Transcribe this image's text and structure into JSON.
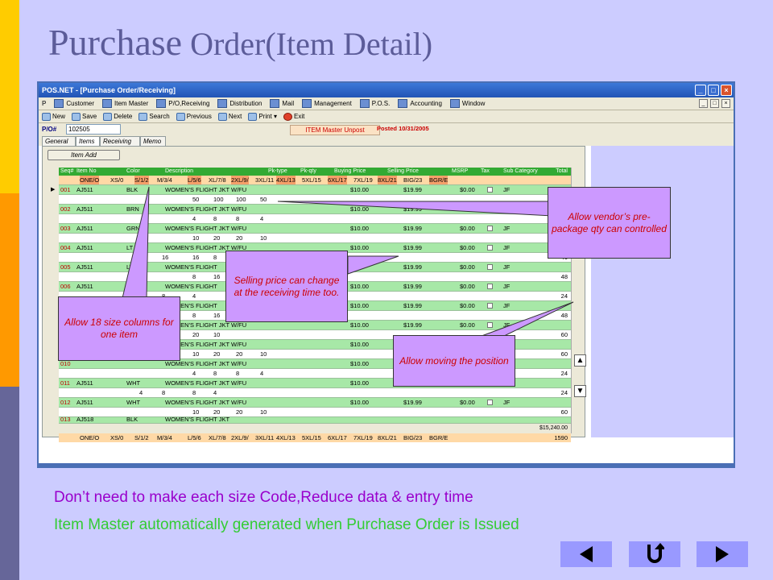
{
  "slide": {
    "title_main": "Purchase",
    "title_rest": " Order(Item Detail)",
    "line1": "Don’t need to make each size Code,Reduce data & entry time",
    "line2": "Item Master automatically generated when Purchase Order is Issued"
  },
  "window": {
    "title": "POS.NET - [Purchase Order/Receiving]",
    "menu": [
      "Customer",
      "Item Master",
      "P/O,Receiving",
      "Distribution",
      "Mail",
      "Management",
      "P.O.S.",
      "Accounting",
      "Window"
    ],
    "toolbar": [
      "New",
      "Save",
      "Delete",
      "Search",
      "Previous",
      "Next",
      "Print ▾",
      "Exit"
    ],
    "po_label": "P/O#",
    "po_number": "102505",
    "unpost_button": "ITEM Master Unpost",
    "posted_text": "Posted 10/31/2005",
    "tabs": [
      "General",
      "Items",
      "Receiving",
      "Memo"
    ],
    "item_add_button": "Item Add",
    "columns": [
      "Seq#",
      "Item No",
      "Color",
      "Description",
      "Pk-type",
      "Pk-qty",
      "Buying Price",
      "Selling Price",
      "MSRP",
      "Tax",
      "Sub Category"
    ],
    "total_col": "Total",
    "size_header": [
      "ONE/O",
      "XS/0",
      "S/1/2",
      "M/3/4",
      "L/5/6",
      "XL/7/8",
      "2XL/9/",
      "3XL/11",
      "4XL/13",
      "5XL/15",
      "6XL/17",
      "7XL/19",
      "8XL/21",
      "BIG/23",
      "BGR/E"
    ],
    "rows": [
      {
        "seq": "001",
        "item": "AJ511",
        "color": "BLK",
        "desc": "WOMEN'S FLIGHT JKT W/FU",
        "buy": "$10.00",
        "sell": "$19.99",
        "msrp": "$0.00",
        "sub": "JF",
        "sizes": [
          "",
          "",
          "",
          "",
          "50",
          "100",
          "100",
          "50"
        ],
        "total": "300"
      },
      {
        "seq": "002",
        "item": "AJ511",
        "color": "BRN",
        "desc": "WOMEN'S FLIGHT JKT W/FU",
        "buy": "$10.00",
        "sell": "$19.99",
        "msrp": "$0.00",
        "sub": "JF",
        "sizes": [
          "",
          "",
          "",
          "",
          "4",
          "8",
          "8",
          "4"
        ],
        "total": "24"
      },
      {
        "seq": "003",
        "item": "AJ511",
        "color": "GRN",
        "desc": "WOMEN'S FLIGHT JKT W/FU",
        "buy": "$10.00",
        "sell": "$19.99",
        "msrp": "$0.00",
        "sub": "JF",
        "sizes": [
          "",
          "",
          "",
          "",
          "10",
          "20",
          "20",
          "10"
        ],
        "total": "60"
      },
      {
        "seq": "004",
        "item": "AJ511",
        "color": "LT E",
        "desc": "WOMEN'S FLIGHT JKT W/FU",
        "buy": "$10.00",
        "sell": "$19.99",
        "msrp": "$0.00",
        "sub": "JF",
        "sizes": [
          "",
          "",
          "",
          "16",
          "16",
          "8",
          "",
          ""
        ],
        "total": "40"
      },
      {
        "seq": "005",
        "item": "AJ511",
        "color": "LT",
        "desc": "WOMEN'S FLIGHT",
        "buy": "",
        "sell": "$19.99",
        "msrp": "$0.00",
        "sub": "JF",
        "sizes": [
          "",
          "",
          "",
          "",
          "8",
          "16",
          "",
          ""
        ],
        "total": "48"
      },
      {
        "seq": "006",
        "item": "AJ511",
        "color": "N",
        "desc": "WOMEN'S FLIGHT",
        "buy": "$10.00",
        "sell": "$19.99",
        "msrp": "$0.00",
        "sub": "JF",
        "sizes": [
          "",
          "",
          "",
          "8",
          "4",
          "",
          "",
          ""
        ],
        "total": "24"
      },
      {
        "seq": "007",
        "item": "",
        "color": "",
        "desc": "WOMEN'S FLIGHT",
        "buy": "$10.00",
        "sell": "$19.99",
        "msrp": "$0.00",
        "sub": "JF",
        "sizes": [
          "",
          "",
          "",
          "",
          "8",
          "16",
          "",
          ""
        ],
        "total": "48"
      },
      {
        "seq": "008",
        "item": "",
        "color": "",
        "desc": "WOMEN'S FLIGHT JKT W/FU",
        "buy": "$10.00",
        "sell": "$19.99",
        "msrp": "$0.00",
        "sub": "JF",
        "sizes": [
          "",
          "",
          "",
          "",
          "20",
          "10",
          "",
          ""
        ],
        "total": "60"
      },
      {
        "seq": "009",
        "item": "",
        "color": "",
        "desc": "WOMEN'S FLIGHT JKT W/FU",
        "buy": "$10.00",
        "sell": "$19.99",
        "msrp": "$0.00",
        "sub": "JF",
        "sizes": [
          "",
          "",
          "",
          "",
          "10",
          "20",
          "20",
          "10"
        ],
        "total": "60"
      },
      {
        "seq": "010",
        "item": "",
        "color": "",
        "desc": "WOMEN'S FLIGHT JKT W/FU",
        "buy": "$10.00",
        "sell": "$19.99",
        "msrp": "$0.00",
        "sub": "JF",
        "sizes": [
          "",
          "",
          "",
          "",
          "4",
          "8",
          "8",
          "4"
        ],
        "total": "24"
      },
      {
        "seq": "011",
        "item": "AJ511",
        "color": "WHT",
        "desc": "WOMEN'S FLIGHT JKT W/FU",
        "buy": "$10.00",
        "sell": "$19.99",
        "msrp": "$0.00",
        "sub": "JF",
        "sizes": [
          "",
          "",
          "4",
          "8",
          "8",
          "4",
          "",
          ""
        ],
        "total": "24"
      },
      {
        "seq": "012",
        "item": "AJ511",
        "color": "WHT",
        "desc": "WOMEN'S FLIGHT JKT W/FU",
        "buy": "$10.00",
        "sell": "$19.99",
        "msrp": "$0.00",
        "sub": "JF",
        "sizes": [
          "",
          "",
          "",
          "",
          "10",
          "20",
          "20",
          "10"
        ],
        "total": "60"
      }
    ],
    "partial_row": {
      "seq": "013",
      "item": "AJ518",
      "color": "BLK",
      "desc": "WOMEN'S FLIGHT JKT"
    },
    "grand_total_amount": "$15,240.00",
    "grand_total_qty": "1590"
  },
  "callouts": {
    "vendor": "Allow vendor’s pre-package qty can controlled",
    "selling": "Selling price can change at the receiving time too.",
    "sizes": "Allow 18 size columns for one item",
    "moving": "Allow moving the position"
  },
  "colors": {
    "title": "#5c5c99",
    "line1": "#9900cc",
    "line2": "#33cc33",
    "callout_bg": "#cc99ff",
    "callout_text": "#cc0000",
    "nav": "#9999ff"
  },
  "icons": [
    "undo-icon",
    "previous-arrow-icon",
    "return-icon",
    "next-arrow-icon",
    "move-up-icon",
    "move-down-icon"
  ]
}
